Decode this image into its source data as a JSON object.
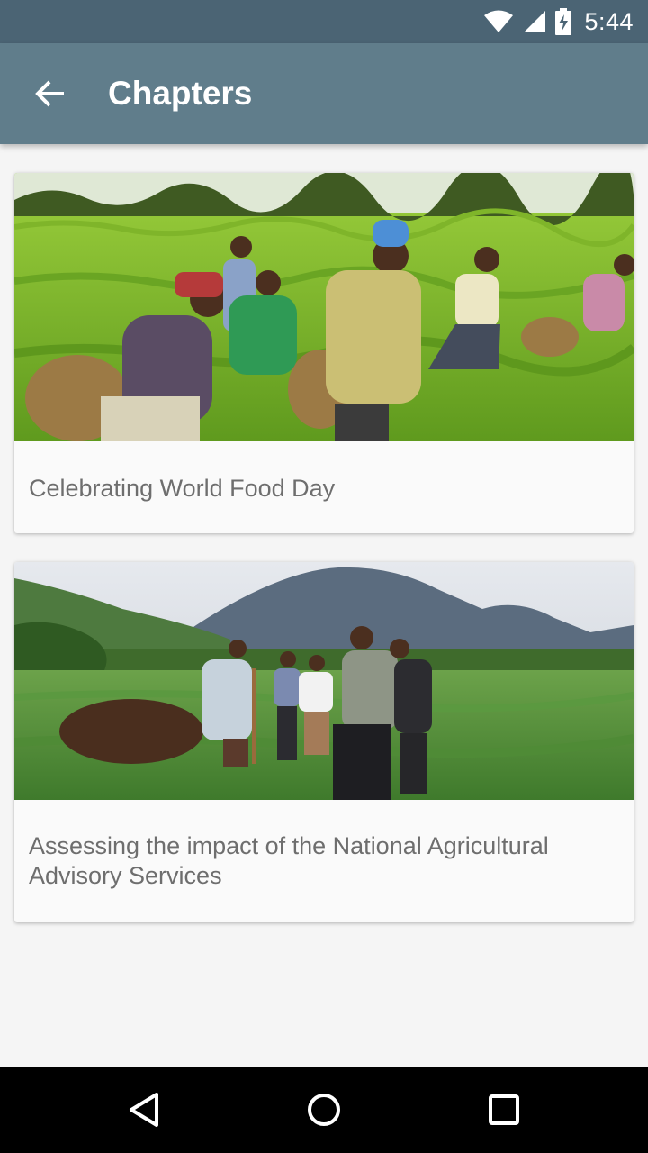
{
  "status_bar": {
    "time": "5:44",
    "icons": [
      "wifi-icon",
      "cell-signal-icon",
      "battery-charging-icon"
    ]
  },
  "app_bar": {
    "title": "Chapters",
    "back_icon": "arrow-back-icon"
  },
  "chapters": [
    {
      "title": "Celebrating World Food Day",
      "image": "tea-pickers-photo"
    },
    {
      "title": "Assessing the impact of the National Agricultural Advisory Services",
      "image": "farmers-field-volcano-photo"
    }
  ],
  "nav_bar": {
    "icons": [
      "back-triangle-icon",
      "home-circle-icon",
      "recents-square-icon"
    ]
  },
  "colors": {
    "status_bar": "#4b6474",
    "app_bar": "#607d8b",
    "background": "#f5f5f5",
    "caption_text": "#6e6e6e"
  }
}
